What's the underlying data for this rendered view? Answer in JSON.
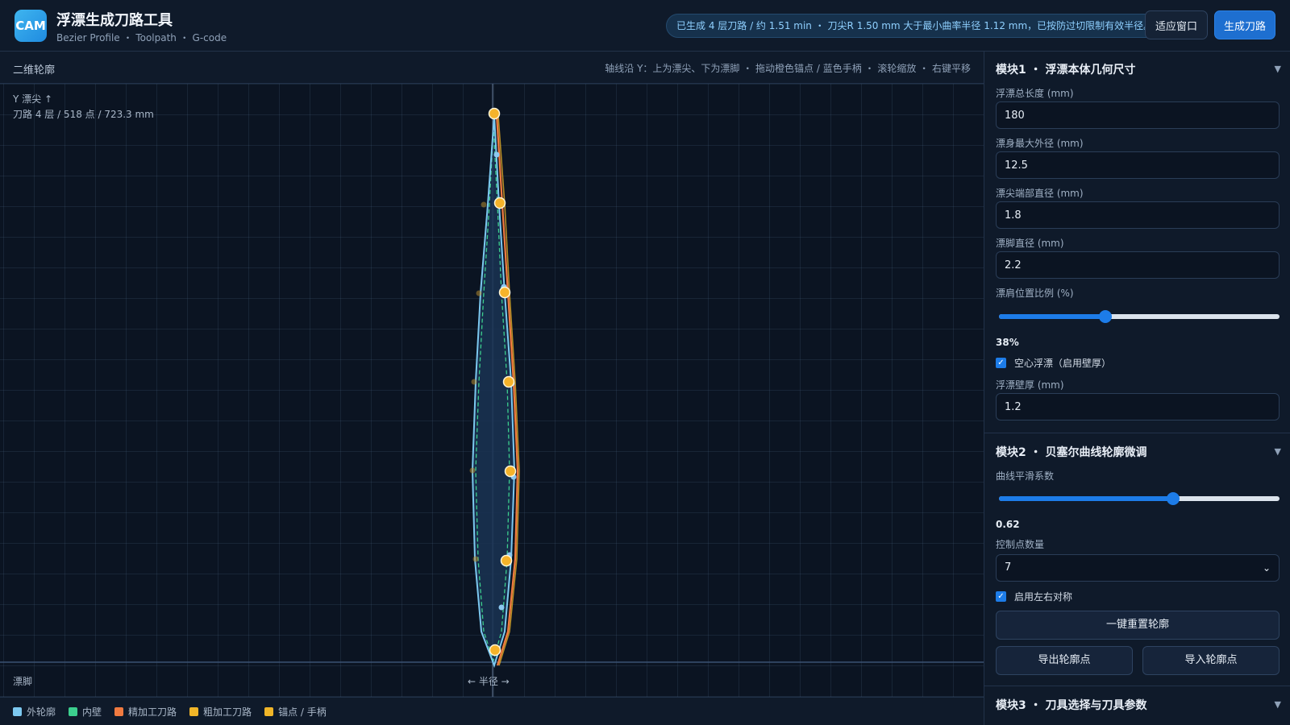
{
  "header": {
    "logo_text": "CAM",
    "title": "浮漂生成刀路工具",
    "subtitle": "Bezier Profile ・ Toolpath ・ G-code",
    "status": "已生成 4 层刀路 / 约 1.51 min ・ 刀尖R 1.50 mm 大于最小曲率半径 1.12 mm，已按防过切限制有效半径。",
    "fit_button": "适应窗口",
    "generate_button": "生成刀路"
  },
  "canvas": {
    "title": "二维轮廓",
    "hint": "轴线沿 Y：上为漂尖、下为漂脚 ・ 拖动橙色锚点 / 蓝色手柄 ・ 滚轮缩放 ・ 右键平移",
    "axis_label": "Y 漂尖 ↑",
    "stats": "刀路 4 层 / 518 点 / 723.3 mm",
    "bottom_label": "漂脚",
    "radius_label": "← 半径 →"
  },
  "legend": [
    {
      "label": "外轮廓",
      "color": "#7cc8f0"
    },
    {
      "label": "内壁",
      "color": "#3ccf8e"
    },
    {
      "label": "精加工刀路",
      "color": "#f07a40"
    },
    {
      "label": "粗加工刀路",
      "color": "#f0b528"
    },
    {
      "label": "锚点 / 手柄",
      "color": "#f0b528"
    }
  ],
  "panel": {
    "section1": {
      "title": "模块1 ・ 浮漂本体几何尺寸",
      "total_length_label": "浮漂总长度 (mm)",
      "total_length": "180",
      "max_diameter_label": "漂身最大外径 (mm)",
      "max_diameter": "12.5",
      "tip_diameter_label": "漂尖端部直径 (mm)",
      "tip_diameter": "1.8",
      "foot_diameter_label": "漂脚直径 (mm)",
      "foot_diameter": "2.2",
      "shoulder_label": "漂肩位置比例 (%)",
      "shoulder_value": "38%",
      "shoulder_fraction": 0.38,
      "hollow_label": "空心浮漂（启用壁厚）",
      "hollow_checked": true,
      "wall_label": "浮漂壁厚 (mm)",
      "wall": "1.2"
    },
    "section2": {
      "title": "模块2 ・ 贝塞尔曲线轮廓微调",
      "smooth_label": "曲线平滑系数",
      "smooth_value": "0.62",
      "smooth_fraction": 0.62,
      "points_label": "控制点数量",
      "points_value": "7",
      "symmetric_label": "启用左右对称",
      "symmetric_checked": true,
      "reset_button": "一键重置轮廓",
      "export_button": "导出轮廓点",
      "import_button": "导入轮廓点"
    },
    "section3": {
      "title": "模块3 ・ 刀具选择与刀具参数"
    }
  }
}
